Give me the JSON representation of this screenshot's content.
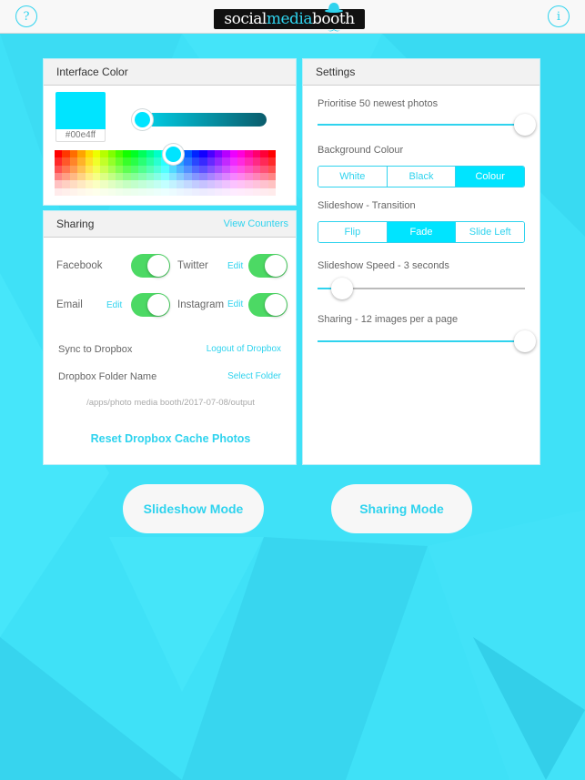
{
  "topbar": {
    "help_icon": "?",
    "info_icon": "i",
    "logo": {
      "part1": "social",
      "part2": "media",
      "part3": "booth"
    }
  },
  "interface_color": {
    "title": "Interface Color",
    "current_hex": "#00e4ff",
    "shade_value": 0.0,
    "palette_selected_column": 14
  },
  "sharing": {
    "title": "Sharing",
    "view_counters_label": "View Counters",
    "services": [
      {
        "label": "Facebook",
        "edit_label": "",
        "enabled": true
      },
      {
        "label": "Twitter",
        "edit_label": "Edit",
        "enabled": true
      },
      {
        "label": "Email",
        "edit_label": "Edit",
        "enabled": true
      },
      {
        "label": "Instagram",
        "edit_label": "Edit",
        "enabled": true
      }
    ],
    "sync_label": "Sync to Dropbox",
    "logout_label": "Logout of Dropbox",
    "folder_label": "Dropbox Folder Name",
    "select_folder_label": "Select Folder",
    "folder_path": "/apps/photo media booth/2017-07-08/output",
    "reset_label": "Reset Dropbox Cache Photos"
  },
  "settings": {
    "title": "Settings",
    "prioritise_label": "Prioritise 50 newest photos",
    "prioritise_value": 1.0,
    "background_label": "Background Colour",
    "background_options": [
      "White",
      "Black",
      "Colour"
    ],
    "background_selected": "Colour",
    "transition_label": "Slideshow - Transition",
    "transition_options": [
      "Flip",
      "Fade",
      "Slide Left"
    ],
    "transition_selected": "Fade",
    "speed_label": "Slideshow Speed - 3 seconds",
    "speed_value": 0.12,
    "sharing_label": "Sharing - 12 images per a page",
    "sharing_value": 1.0
  },
  "modes": {
    "slideshow_label": "Slideshow Mode",
    "sharing_label": "Sharing Mode"
  },
  "colors": {
    "accent": "#2fd3ee",
    "interface": "#00e4ff",
    "toggle_on": "#4cd964",
    "background": "#3fe1f7"
  }
}
